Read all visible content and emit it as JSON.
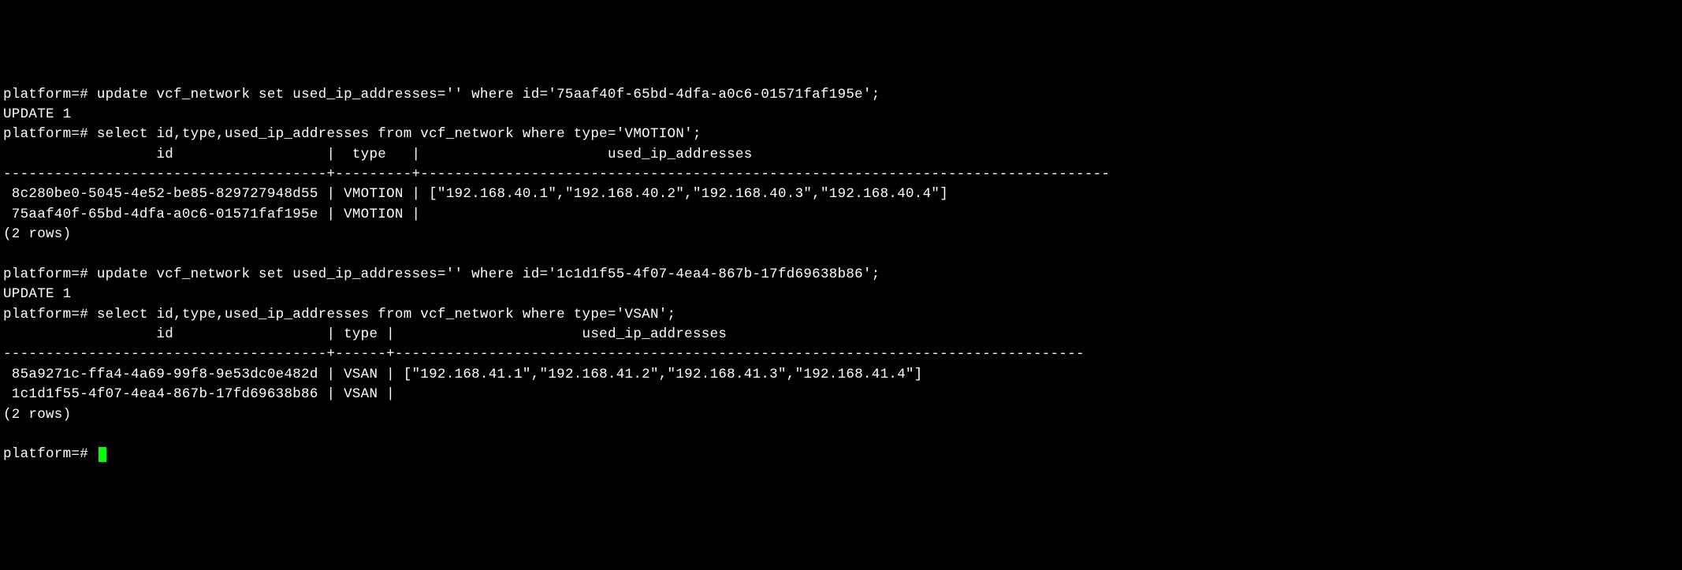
{
  "prompt": "platform=# ",
  "lines": {
    "cmd1": "update vcf_network set used_ip_addresses='' where id='75aaf40f-65bd-4dfa-a0c6-01571faf195e';",
    "result1": "UPDATE 1",
    "cmd2": "select id,type,used_ip_addresses from vcf_network where type='VMOTION';",
    "header1_id": "                  id                  ",
    "header1_type": "  type   ",
    "header1_addresses": "                      used_ip_addresses",
    "sep1": "--------------------------------------+---------+---------------------------------------------------------------------------------",
    "row1_id": " 8c280be0-5045-4e52-be85-829727948d55 ",
    "row1_type": " VMOTION ",
    "row1_addresses": " [\"192.168.40.1\",\"192.168.40.2\",\"192.168.40.3\",\"192.168.40.4\"]",
    "row2_id": " 75aaf40f-65bd-4dfa-a0c6-01571faf195e ",
    "row2_type": " VMOTION ",
    "row2_addresses": "",
    "rowcount1": "(2 rows)",
    "blank1": "",
    "cmd3": "update vcf_network set used_ip_addresses='' where id='1c1d1f55-4f07-4ea4-867b-17fd69638b86';",
    "result2": "UPDATE 1",
    "cmd4": "select id,type,used_ip_addresses from vcf_network where type='VSAN';",
    "header2_id": "                  id                  ",
    "header2_type": " type ",
    "header2_addresses": "                      used_ip_addresses",
    "sep2": "--------------------------------------+------+---------------------------------------------------------------------------------",
    "row3_id": " 85a9271c-ffa4-4a69-99f8-9e53dc0e482d ",
    "row3_type": " VSAN ",
    "row3_addresses": " [\"192.168.41.1\",\"192.168.41.2\",\"192.168.41.3\",\"192.168.41.4\"]",
    "row4_id": " 1c1d1f55-4f07-4ea4-867b-17fd69638b86 ",
    "row4_type": " VSAN ",
    "row4_addresses": "",
    "rowcount2": "(2 rows)",
    "blank2": ""
  },
  "pipe": "|"
}
